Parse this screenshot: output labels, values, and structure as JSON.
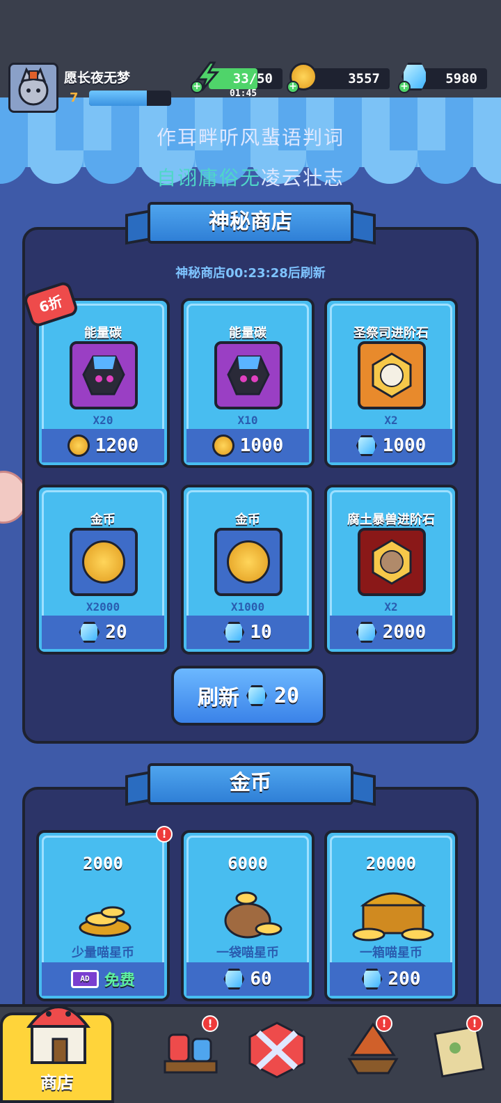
{
  "player": {
    "name": "愿长夜无梦",
    "level": "7",
    "xp_fraction": 0.7
  },
  "resources": {
    "energy": {
      "value": "33/50",
      "timer": "01:45",
      "fill_fraction": 0.66
    },
    "coins": {
      "value": "3557"
    },
    "gems": {
      "value": "5980"
    }
  },
  "poem": {
    "line1": "作耳畔听风蜚语判词",
    "line2_highlight": "自诩庸俗无",
    "line2_rest": "凌云壮志"
  },
  "mystery_shop": {
    "title": "神秘商店",
    "refresh_note": "神秘商店00:23:28后刷新",
    "discount_badge": "6折",
    "items": [
      {
        "name": "能量碳",
        "qty": "X20",
        "price": "1200",
        "currency": "coin"
      },
      {
        "name": "能量碳",
        "qty": "X10",
        "price": "1000",
        "currency": "coin"
      },
      {
        "name": "圣祭司进阶石",
        "qty": "X2",
        "price": "1000",
        "currency": "gem"
      },
      {
        "name": "金币",
        "qty": "X2000",
        "price": "20",
        "currency": "gem"
      },
      {
        "name": "金币",
        "qty": "X1000",
        "price": "10",
        "currency": "gem"
      },
      {
        "name": "腐土暴兽进阶石",
        "qty": "X2",
        "price": "2000",
        "currency": "gem"
      }
    ],
    "refresh_button": {
      "label": "刷新",
      "price": "20"
    }
  },
  "gold_shop": {
    "title": "金币",
    "packs": [
      {
        "amount": "2000",
        "label": "少量喵星币",
        "price": "免费",
        "price_type": "ad"
      },
      {
        "amount": "6000",
        "label": "一袋喵星币",
        "price": "60",
        "price_type": "gem"
      },
      {
        "amount": "20000",
        "label": "一箱喵星币",
        "price": "200",
        "price_type": "gem"
      }
    ]
  },
  "bottom_nav": {
    "shop_label": "商店",
    "ad_tag": "AD"
  },
  "alert_mark": "!",
  "colors": {
    "accent": "#48bdf0",
    "panel": "#2c3468",
    "highlight_text": "#4fd6c8",
    "gold": "#ffd43a"
  }
}
